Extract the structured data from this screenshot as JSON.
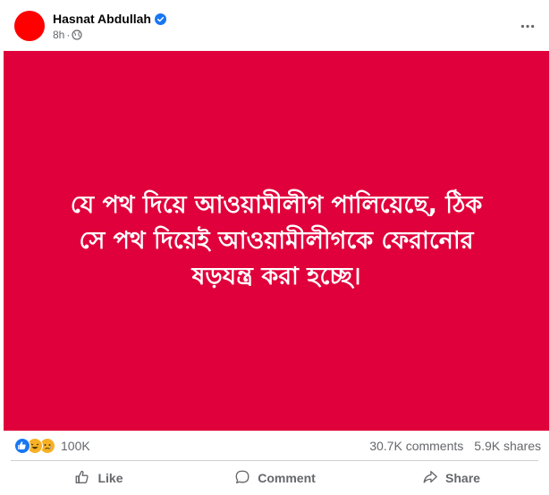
{
  "post": {
    "author": "Hasnat Abdullah",
    "time": "8h",
    "dot": "·",
    "banner_line1": "যে পথ দিয়ে আওয়ামীলীগ পালিয়েছে, ঠিক",
    "banner_line2": "সে পথ দিয়েই আওয়ামীলীগকে ফেরানোর",
    "banner_line3": "ষড়যন্ত্র করা হচ্ছে।",
    "banner_color": "#e0003b",
    "avatar_color": "#ff0000"
  },
  "stats": {
    "reactions_count": "100K",
    "comments": "30.7K comments",
    "shares": "5.9K shares",
    "reaction_icons": [
      "like-icon",
      "haha-icon",
      "sad-icon"
    ]
  },
  "actions": {
    "like": "Like",
    "comment": "Comment",
    "share": "Share"
  },
  "icons": {
    "verified": "verified-badge-icon",
    "globe": "globe-icon",
    "more": "more-options-icon"
  }
}
